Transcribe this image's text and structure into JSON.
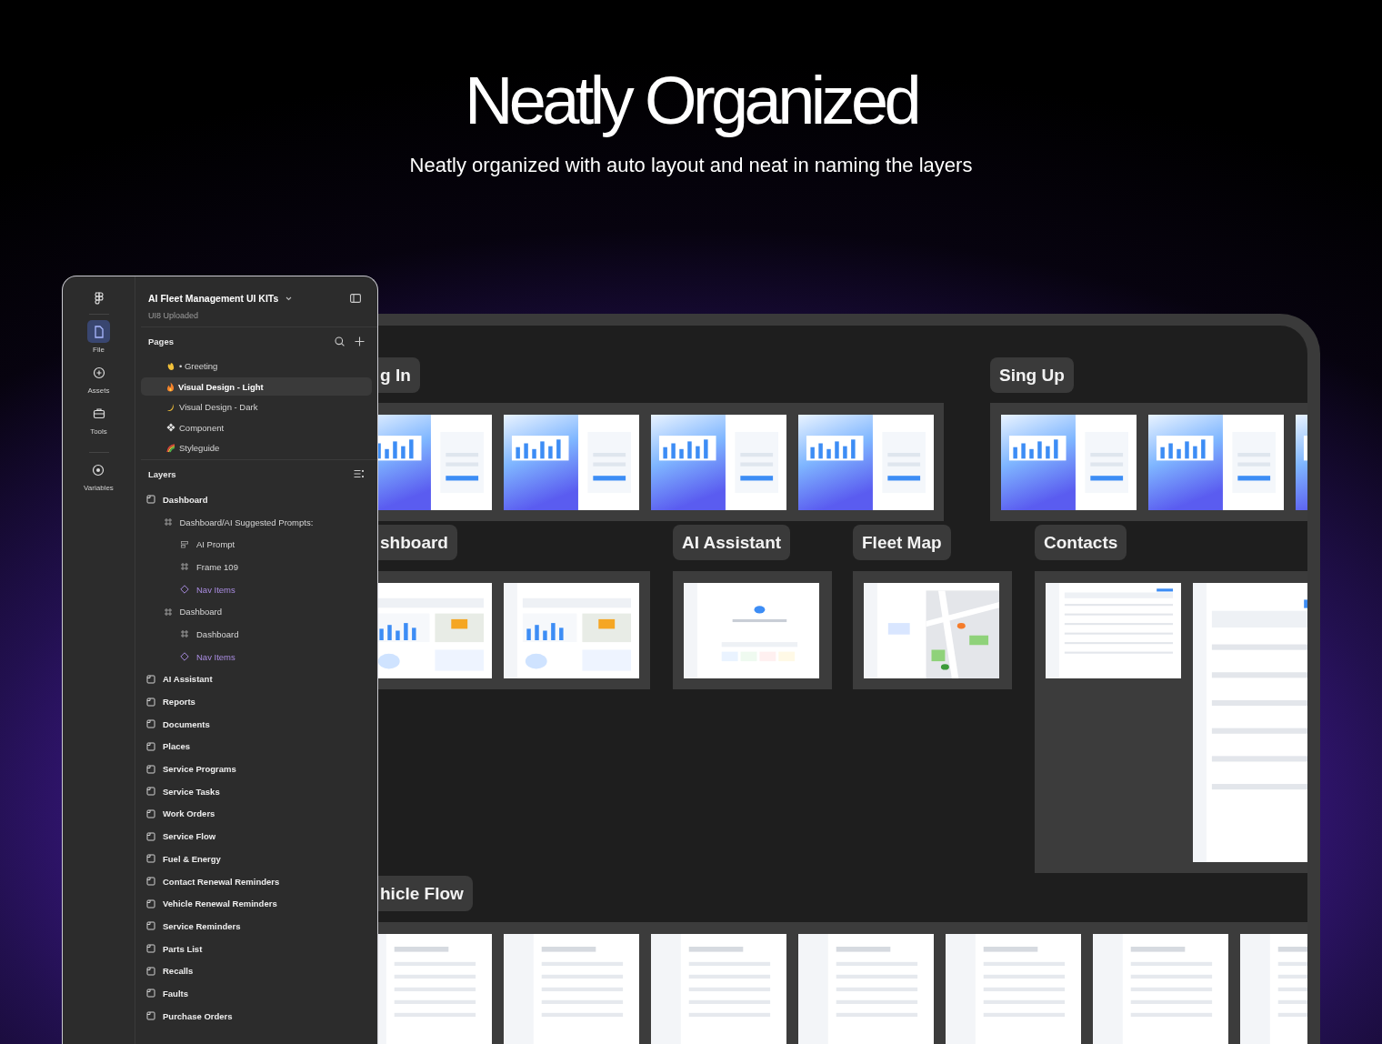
{
  "hero": {
    "title": "Neatly Organized",
    "subtitle": "Neatly organized with auto layout and neat in naming the layers"
  },
  "canvas": {
    "sections": [
      {
        "label": "g In"
      },
      {
        "label": "Sing Up"
      },
      {
        "label": "shboard"
      },
      {
        "label": "AI Assistant"
      },
      {
        "label": "Fleet Map"
      },
      {
        "label": "Contacts"
      },
      {
        "label": "hicle Flow"
      }
    ]
  },
  "panel": {
    "rail": [
      {
        "label": "File",
        "selected": true
      },
      {
        "label": "Assets",
        "selected": false
      },
      {
        "label": "Tools",
        "selected": false
      },
      {
        "label": "Variables",
        "selected": false
      }
    ],
    "file": {
      "title": "AI Fleet Management UI KITs",
      "subtitle": "UI8 Uploaded"
    },
    "pages": {
      "title": "Pages",
      "items": [
        {
          "label": "• Greeting",
          "selected": false
        },
        {
          "label": "Visual Design - Light",
          "selected": true
        },
        {
          "label": "Visual Design - Dark",
          "selected": false
        },
        {
          "label": "Component",
          "selected": false
        },
        {
          "label": "Styleguide",
          "selected": false
        }
      ]
    },
    "layers": {
      "title": "Layers",
      "items": [
        {
          "name": "Dashboard",
          "kind": "section",
          "children": [
            {
              "name": "Dashboard/AI Suggested Prompts:",
              "kind": "frame",
              "children": [
                {
                  "name": "AI Prompt",
                  "kind": "autolayout"
                },
                {
                  "name": "Frame 109",
                  "kind": "frame"
                },
                {
                  "name": "Nav Items",
                  "kind": "instance"
                }
              ]
            },
            {
              "name": "Dashboard",
              "kind": "frame",
              "children": [
                {
                  "name": "Dashboard",
                  "kind": "frame"
                },
                {
                  "name": "Nav Items",
                  "kind": "instance"
                }
              ]
            }
          ]
        },
        {
          "name": "AI Assistant",
          "kind": "section"
        },
        {
          "name": "Reports",
          "kind": "section"
        },
        {
          "name": "Documents",
          "kind": "section"
        },
        {
          "name": "Places",
          "kind": "section"
        },
        {
          "name": "Service Programs",
          "kind": "section"
        },
        {
          "name": "Service Tasks",
          "kind": "section"
        },
        {
          "name": "Work Orders",
          "kind": "section"
        },
        {
          "name": "Service Flow",
          "kind": "section"
        },
        {
          "name": "Fuel & Energy",
          "kind": "section"
        },
        {
          "name": "Contact Renewal Reminders",
          "kind": "section"
        },
        {
          "name": "Vehicle Renewal Reminders",
          "kind": "section"
        },
        {
          "name": "Service Reminders",
          "kind": "section"
        },
        {
          "name": "Parts List",
          "kind": "section"
        },
        {
          "name": "Recalls",
          "kind": "section"
        },
        {
          "name": "Faults",
          "kind": "section"
        },
        {
          "name": "Purchase Orders",
          "kind": "section"
        }
      ]
    }
  }
}
